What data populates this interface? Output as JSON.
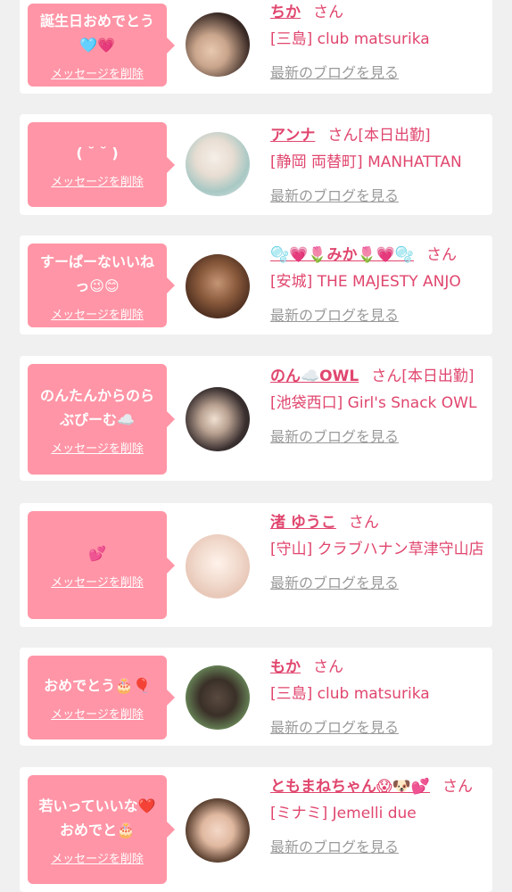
{
  "delete_label": "メッセージを削除",
  "blog_label": "最新のブログを見る",
  "san_label": "さん",
  "accent_color": "#e0466e",
  "bubble_color": "#ff95a6",
  "entries": [
    {
      "message": "誕生日おめでとう\n🩵💗",
      "name": "ちか",
      "suffix": "",
      "shop": "[三島] club matsurika"
    },
    {
      "message": "( ˘ ˘ )",
      "name": "アンナ",
      "suffix": "[本日出勤]",
      "shop": "[静岡 両替町] MANHATTAN"
    },
    {
      "message": "すーぱーないいね\nっ😉😊",
      "name": "🫧💗🌷みか🌷💗🫧",
      "suffix": "",
      "shop": "[安城] THE MAJESTY ANJO"
    },
    {
      "message": "のんたんからのら\nぶぴーむ☁️",
      "name": "のん☁️OWL",
      "suffix": "[本日出勤]",
      "shop": "[池袋西口] Girl's Snack OWL"
    },
    {
      "message": "💕",
      "name": "渚 ゆうこ",
      "suffix": "",
      "shop": "[守山] クラブハナン草津守山店"
    },
    {
      "message": "おめでとう🎂🎈",
      "name": "もか",
      "suffix": "",
      "shop": "[三島] club matsurika"
    },
    {
      "message": "若いっていいな❤️\nおめでと🎂",
      "name": "ともまねちゃん😱🐶💕",
      "suffix": "",
      "shop": "[ミナミ] Jemelli due"
    }
  ]
}
